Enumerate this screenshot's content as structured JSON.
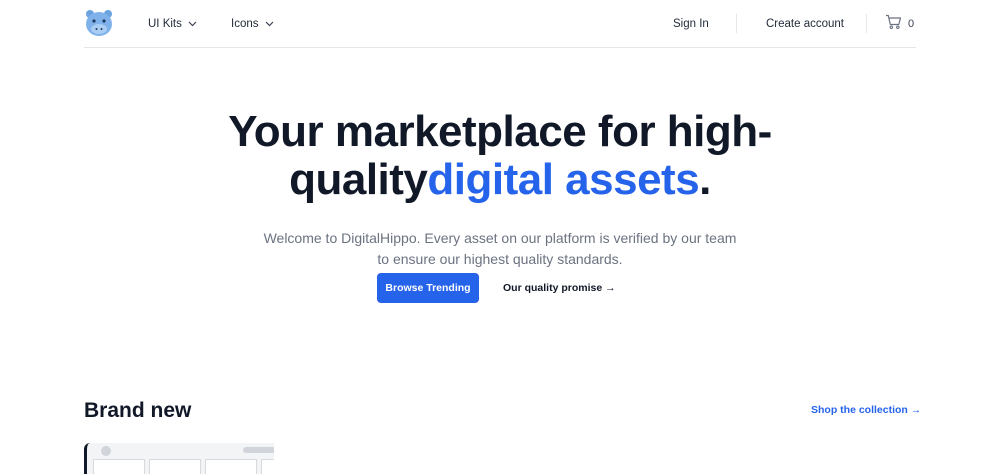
{
  "nav": {
    "logo_name": "hippo-logo",
    "items": [
      {
        "label": "UI Kits"
      },
      {
        "label": "Icons"
      }
    ],
    "sign_in": "Sign In",
    "create_account": "Create account",
    "cart_count": "0"
  },
  "hero": {
    "title_line1": "Your marketplace for high-",
    "title_line2_plain": "quality",
    "title_line2_accent": "digital assets",
    "title_line2_end": ".",
    "subtitle": "Welcome to DigitalHippo. Every asset on our platform is verified by our team to ensure our highest quality standards.",
    "primary_button": "Browse Trending",
    "secondary_button": "Our quality promise →"
  },
  "brand_new": {
    "title": "Brand new",
    "link": "Shop the collection →"
  },
  "colors": {
    "accent": "#2563eb",
    "text": "#111827",
    "muted": "#6b7280"
  }
}
